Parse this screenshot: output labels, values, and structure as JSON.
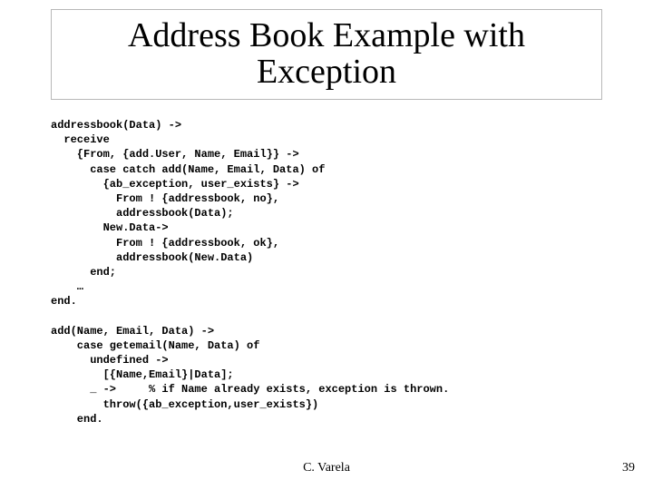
{
  "title": {
    "line1": "Address Book Example with",
    "line2": "Exception"
  },
  "code": "addressbook(Data) ->\n  receive\n    {From, {add.User, Name, Email}} ->\n      case catch add(Name, Email, Data) of\n        {ab_exception, user_exists} ->\n          From ! {addressbook, no},\n          addressbook(Data);\n        New.Data->\n          From ! {addressbook, ok},\n          addressbook(New.Data)\n      end;\n    …\nend.\n\nadd(Name, Email, Data) ->\n    case getemail(Name, Data) of\n      undefined ->\n        [{Name,Email}|Data];\n      _ ->     % if Name already exists, exception is thrown.\n        throw({ab_exception,user_exists})\n    end.",
  "footer": {
    "author": "C. Varela",
    "page": "39"
  }
}
